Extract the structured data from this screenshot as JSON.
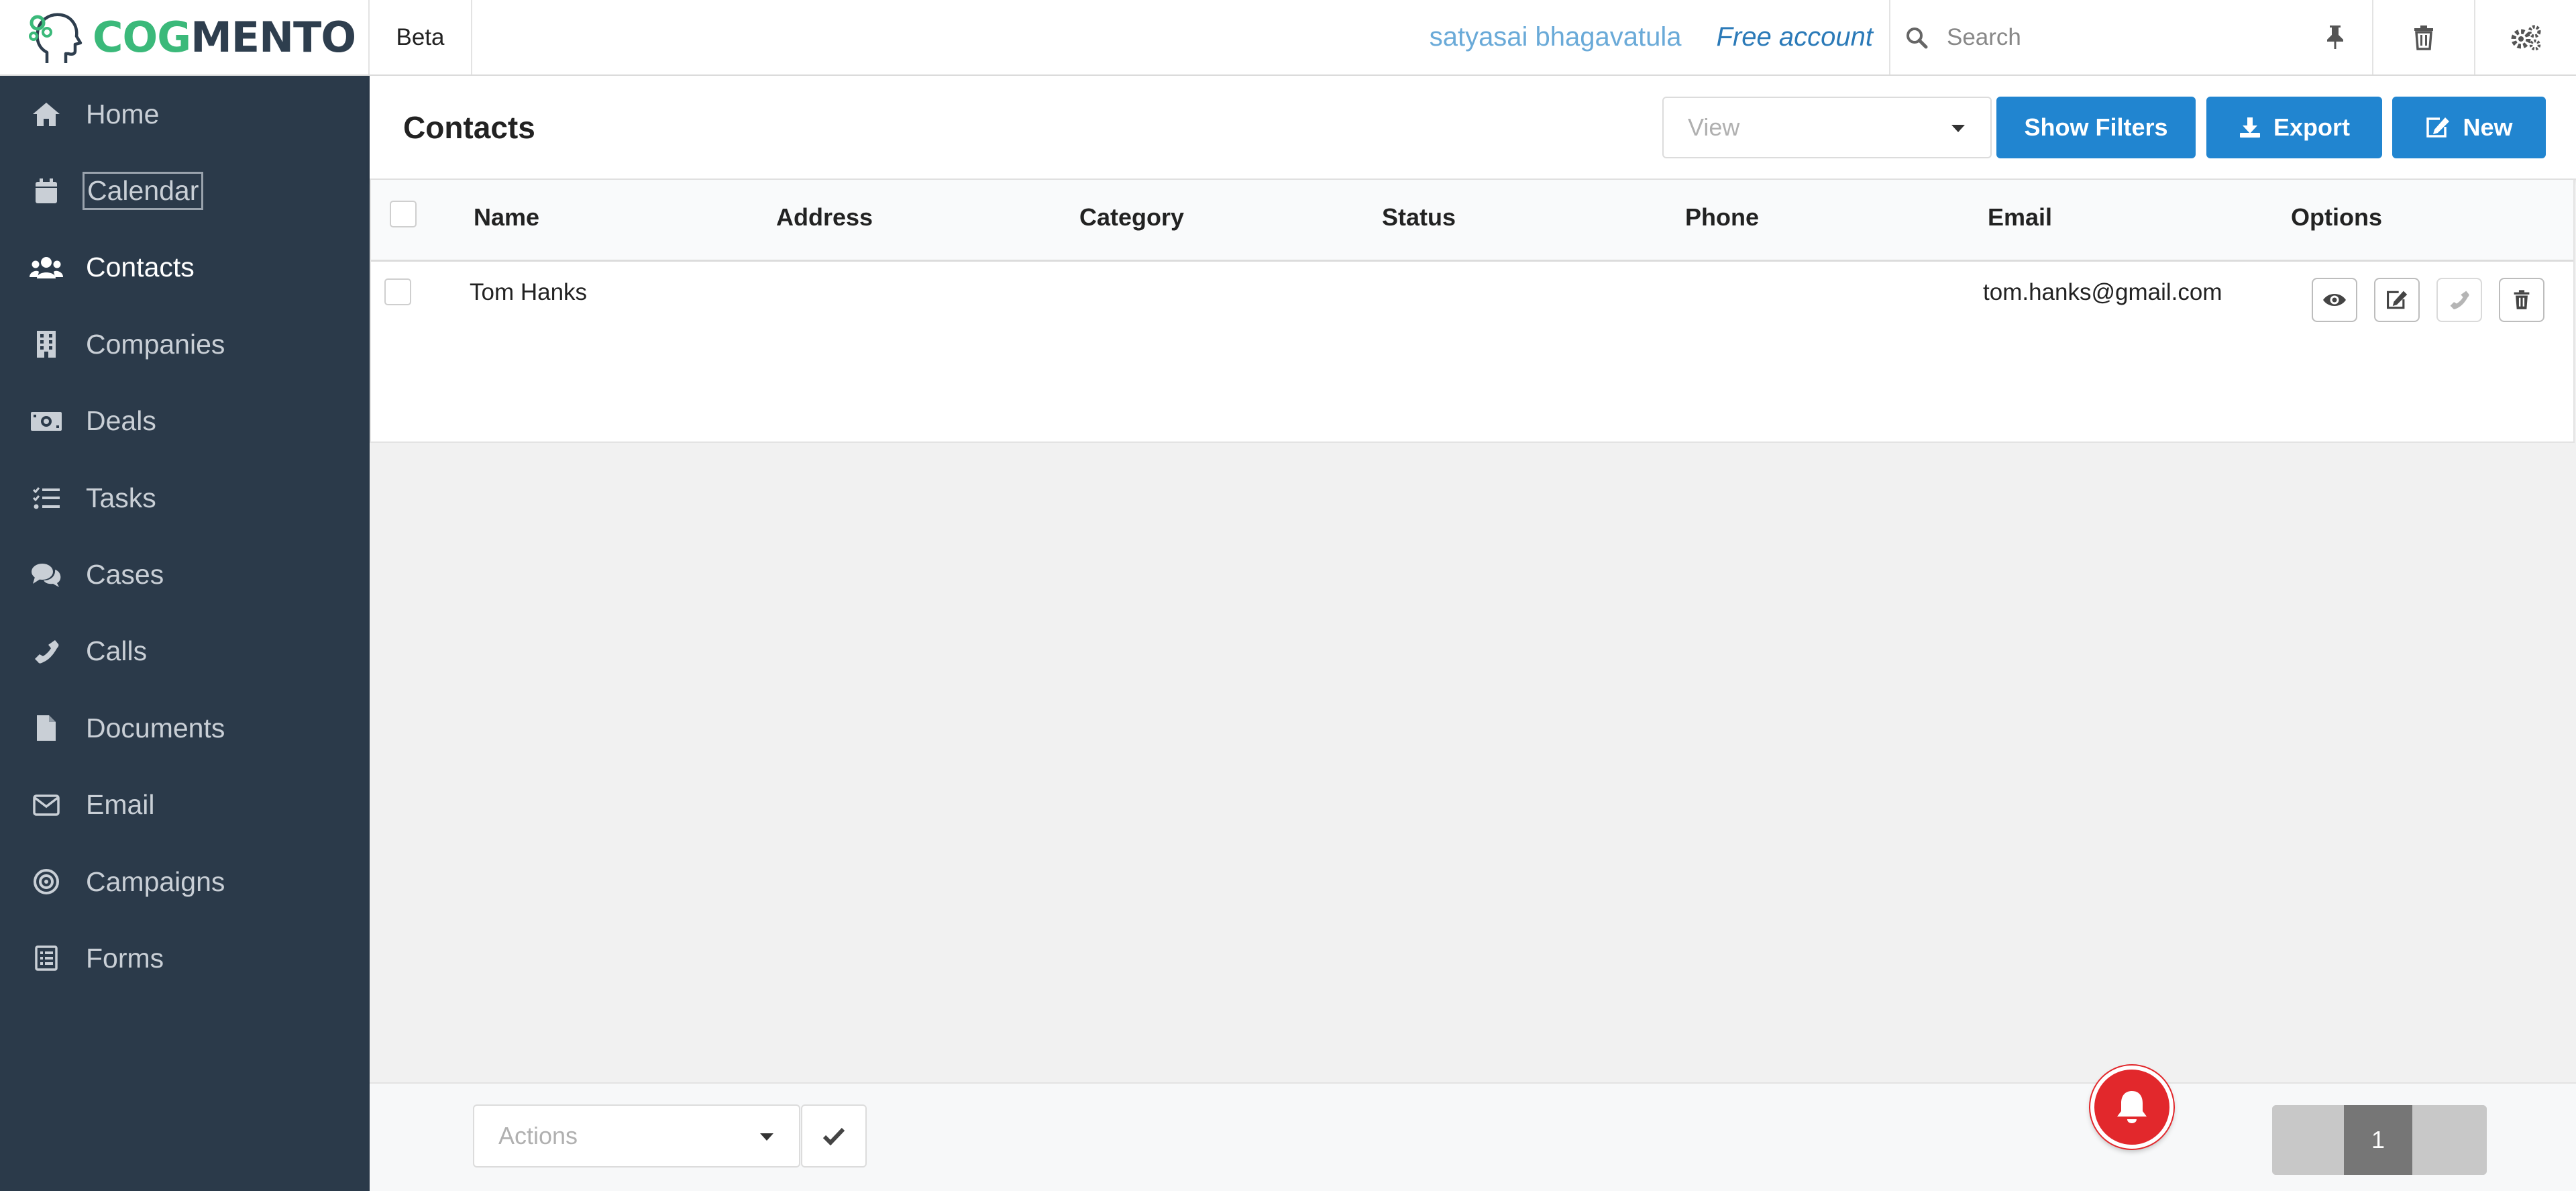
{
  "app": {
    "logo_part1": "COG",
    "logo_part2": "MENTO",
    "edition": "Beta",
    "user_name": "satyasai bhagavatula",
    "account_type": "Free account"
  },
  "search": {
    "placeholder": "Search"
  },
  "sidebar": {
    "items": [
      {
        "label": "Home",
        "icon": "home-icon"
      },
      {
        "label": "Calendar",
        "icon": "calendar-icon"
      },
      {
        "label": "Contacts",
        "icon": "users-icon"
      },
      {
        "label": "Companies",
        "icon": "building-icon"
      },
      {
        "label": "Deals",
        "icon": "money-icon"
      },
      {
        "label": "Tasks",
        "icon": "tasks-icon"
      },
      {
        "label": "Cases",
        "icon": "comments-icon"
      },
      {
        "label": "Calls",
        "icon": "phone-icon"
      },
      {
        "label": "Documents",
        "icon": "file-icon"
      },
      {
        "label": "Email",
        "icon": "envelope-icon"
      },
      {
        "label": "Campaigns",
        "icon": "bullseye-icon"
      },
      {
        "label": "Forms",
        "icon": "form-icon"
      }
    ],
    "active": "Contacts",
    "focused": "Calendar"
  },
  "page": {
    "title": "Contacts",
    "view_placeholder": "View",
    "show_filters_label": "Show Filters",
    "export_label": "Export",
    "new_label": "New"
  },
  "table": {
    "columns": [
      "Name",
      "Address",
      "Category",
      "Status",
      "Phone",
      "Email",
      "Options"
    ],
    "rows": [
      {
        "name": "Tom Hanks",
        "address": "",
        "category": "",
        "status": "",
        "phone": "",
        "email": "tom.hanks@gmail.com"
      }
    ]
  },
  "footer": {
    "actions_placeholder": "Actions",
    "current_page": "1"
  },
  "colors": {
    "sidebar_bg": "#2b3a4a",
    "primary_button": "#2185d0",
    "logo_green": "#3bb97a",
    "logo_dark": "#2e3e4e",
    "notification_red": "#e2282c"
  }
}
